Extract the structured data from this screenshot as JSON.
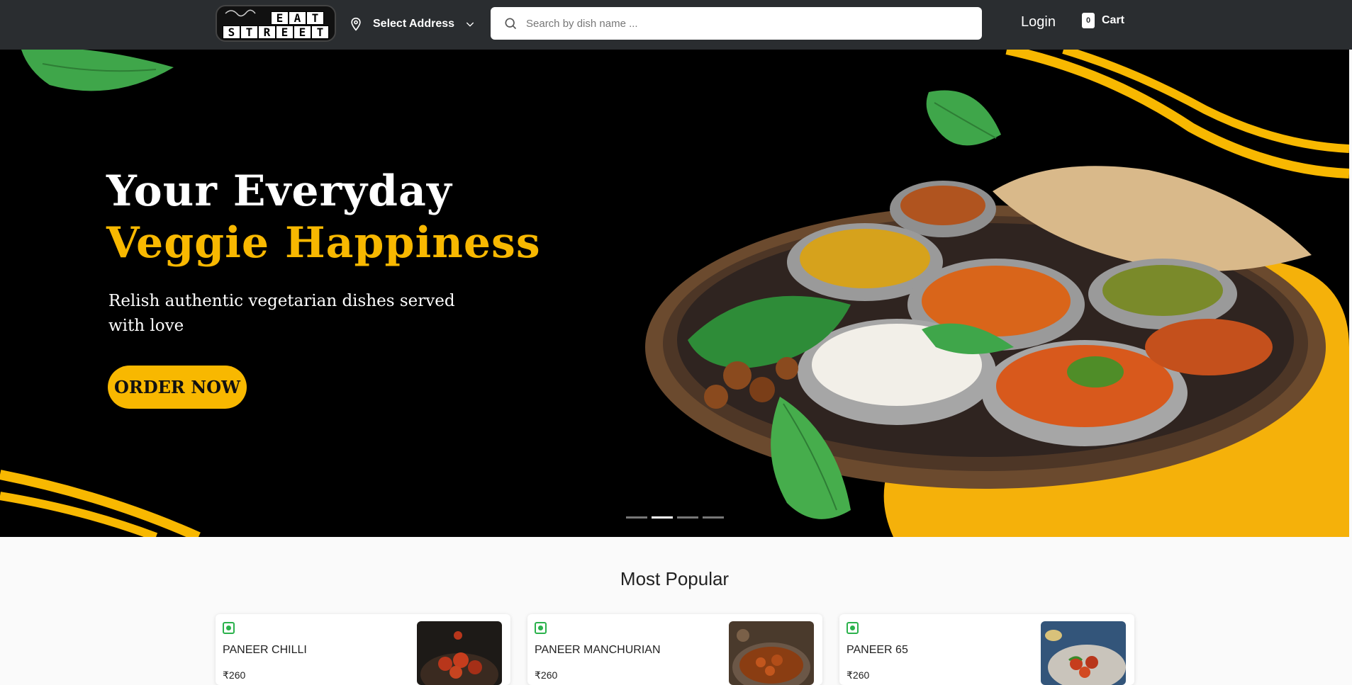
{
  "header": {
    "logo_text_top": "EAT",
    "logo_text_bottom": "STREET",
    "logo_script": "The Veg",
    "address_label": "Select Address",
    "search_placeholder": "Search by dish name ...",
    "login_label": "Login",
    "cart_count": "0",
    "cart_label": "Cart"
  },
  "hero": {
    "title_line1": "Your Everyday",
    "title_line2": "Veggie Happiness",
    "subtitle": "Relish authentic vegetarian dishes served with love",
    "cta_label": "ORDER NOW",
    "slides": 4,
    "active_slide": 2,
    "colors": {
      "accent": "#f8b800",
      "background": "#000000"
    }
  },
  "popular": {
    "title": "Most Popular",
    "items": [
      {
        "name": "PANEER CHILLI",
        "price": "₹260",
        "veg": true
      },
      {
        "name": "PANEER MANCHURIAN",
        "price": "₹260",
        "veg": true
      },
      {
        "name": "PANEER 65",
        "price": "₹260",
        "veg": true
      }
    ]
  }
}
